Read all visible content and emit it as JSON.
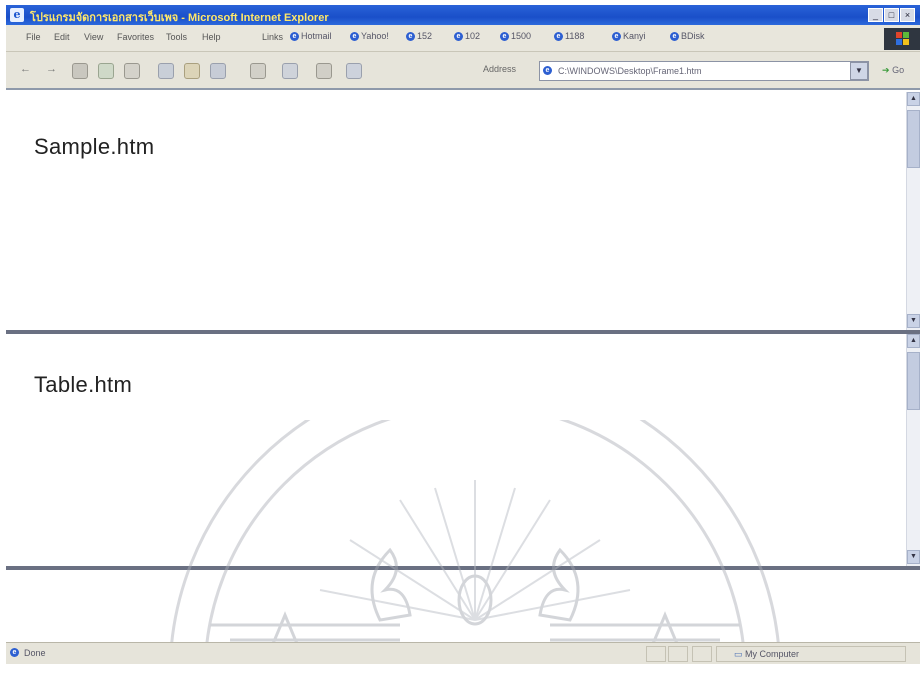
{
  "window": {
    "title": "โปรแกรมจัดการเอกสารเว็บเพจ - Microsoft Internet Explorer",
    "min_label": "_",
    "max_label": "□",
    "close_label": "×"
  },
  "menu": [
    "File",
    "Edit",
    "View",
    "Favorites",
    "Tools",
    "Help"
  ],
  "links": {
    "label": "Links",
    "items": [
      "Hotmail",
      "Yahoo!",
      "152",
      "102",
      "1500",
      "1188",
      "Kanyi",
      "BDisk"
    ]
  },
  "toolbar": {
    "back_label": "←",
    "forward_label": "→",
    "address_label": "Address",
    "address_value": "C:\\WINDOWS\\Desktop\\Frame1.htm",
    "go_label": "Go"
  },
  "frames": [
    {
      "label": "Sample.htm"
    },
    {
      "label": "Table.htm"
    },
    {
      "label": ""
    }
  ],
  "status": {
    "text": "Done",
    "zone": "My Computer"
  },
  "colors": {
    "titlebar": "#1a4fc9",
    "title_text": "#ffe86a",
    "splitter": "#6a7082",
    "watermark": "#a9adb6"
  },
  "icons": [
    "ie-page-icon",
    "stop-icon",
    "refresh-icon",
    "home-icon",
    "search-icon",
    "favorites-icon",
    "history-icon",
    "mail-icon",
    "print-icon",
    "edit-icon",
    "discuss-icon"
  ]
}
